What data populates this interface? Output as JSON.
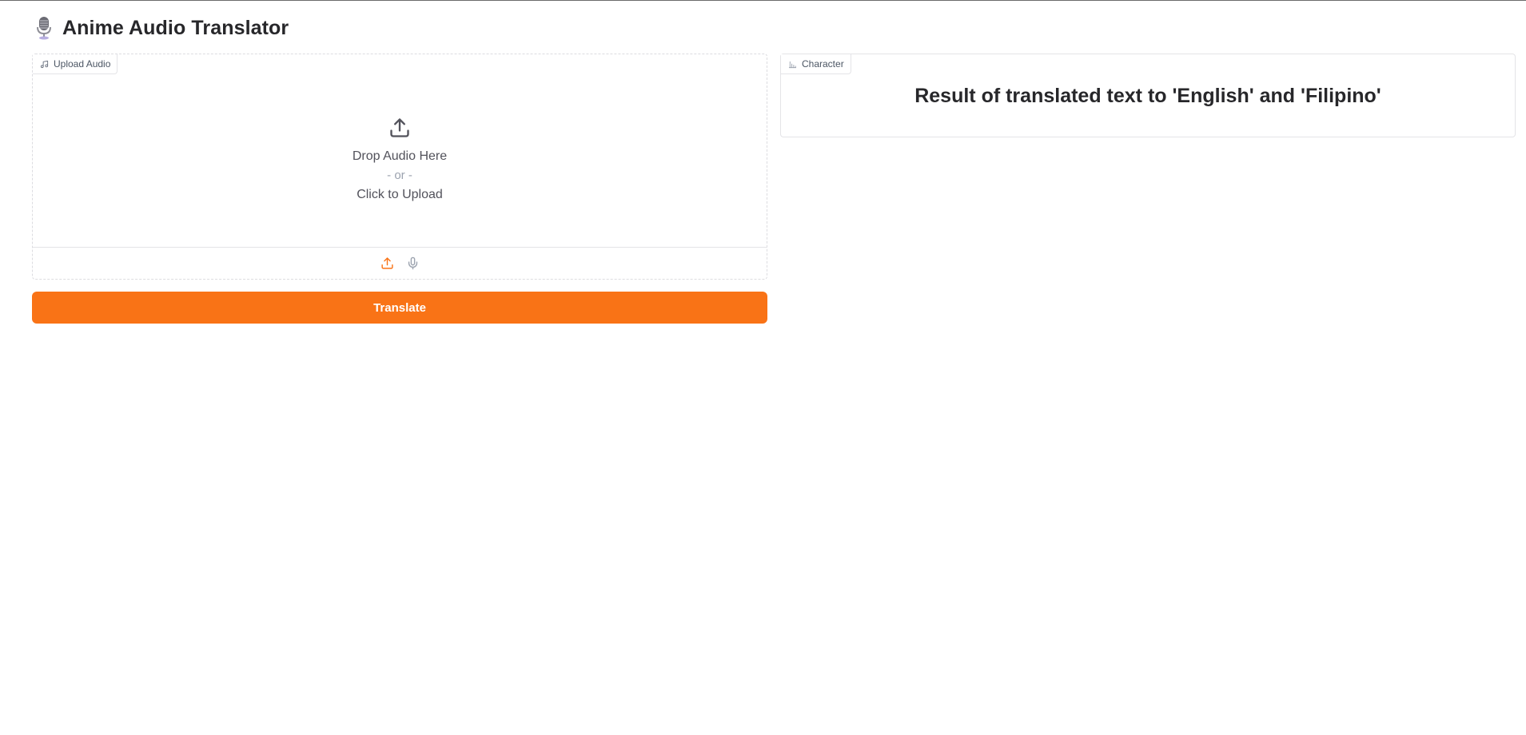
{
  "app": {
    "title": "Anime Audio Translator",
    "title_icon": "microphone-emoji"
  },
  "upload": {
    "label": "Upload Audio",
    "label_icon": "music-note-icon",
    "drop_text": "Drop Audio Here",
    "or_text": "- or -",
    "click_text": "Click to Upload",
    "sources": [
      "upload-icon",
      "microphone-icon"
    ]
  },
  "translate_button": {
    "label": "Translate"
  },
  "character": {
    "label": "Character",
    "label_icon": "bar-chart-icon",
    "result_text": "Result of translated text to 'English' and 'Filipino'"
  },
  "colors": {
    "accent": "#f97316",
    "border": "#e4e4e7",
    "text": "#27272a"
  }
}
